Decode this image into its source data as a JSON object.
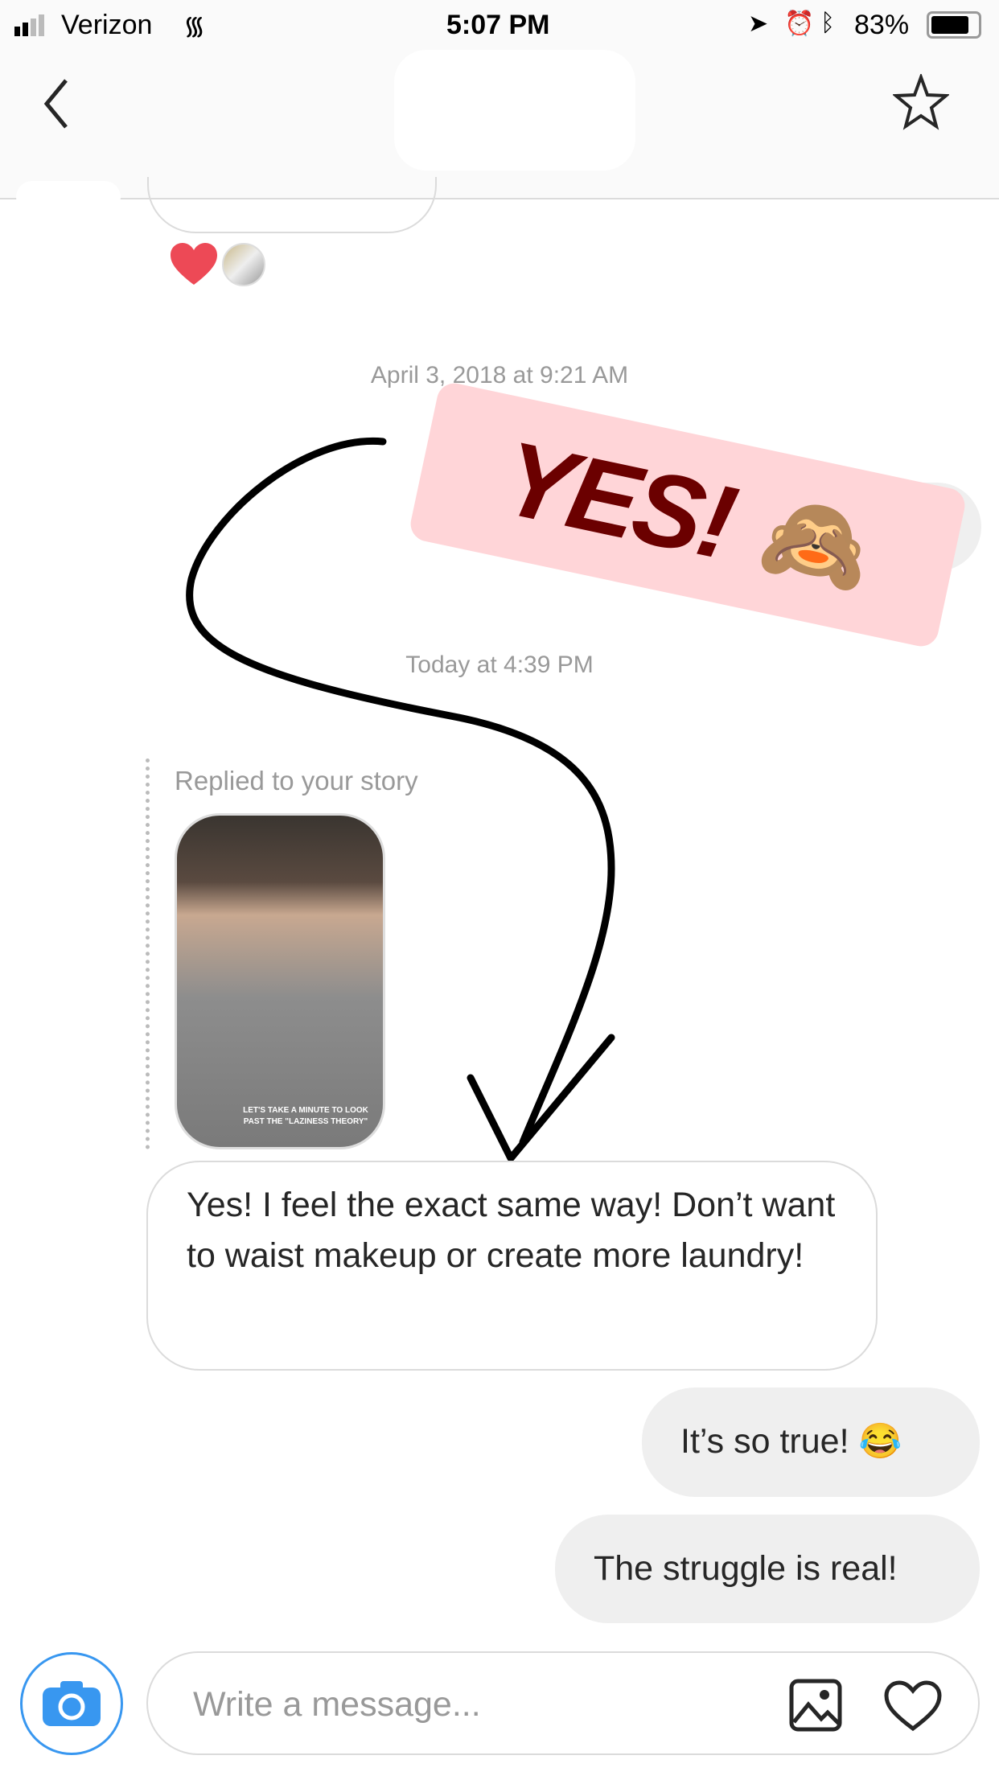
{
  "status_bar": {
    "carrier": "Verizon",
    "time": "5:07 PM",
    "battery": "83%",
    "battery_level": 0.83
  },
  "nav": {
    "back_icon": "chevron-left-icon",
    "star_icon": "star-outline-icon"
  },
  "reaction": {
    "icon": "heart-icon",
    "color": "#ed4956"
  },
  "timestamps": [
    "April 3, 2018 at 9:21 AM",
    "Today at 4:39 PM"
  ],
  "sticker": {
    "text": "YES!",
    "emoji": "🙈",
    "bg": "#ffd5d8",
    "text_color": "#6b0000"
  },
  "story_reply": {
    "label": "Replied to your story",
    "caption": "LET'S TAKE A MINUTE TO LOOK PAST THE \"LAZINESS THEORY\""
  },
  "messages": [
    {
      "from": "them",
      "text": "Yes! I feel the exact same way! Don’t want to waist makeup or create more laundry!"
    },
    {
      "from": "me",
      "text": "It’s so true! 😂"
    },
    {
      "from": "me",
      "text": "The struggle is real!"
    }
  ],
  "composer": {
    "placeholder": "Write a message...",
    "camera_icon": "camera-icon",
    "gallery_icon": "image-icon",
    "like_icon": "heart-outline-icon",
    "accent": "#3897f0"
  }
}
